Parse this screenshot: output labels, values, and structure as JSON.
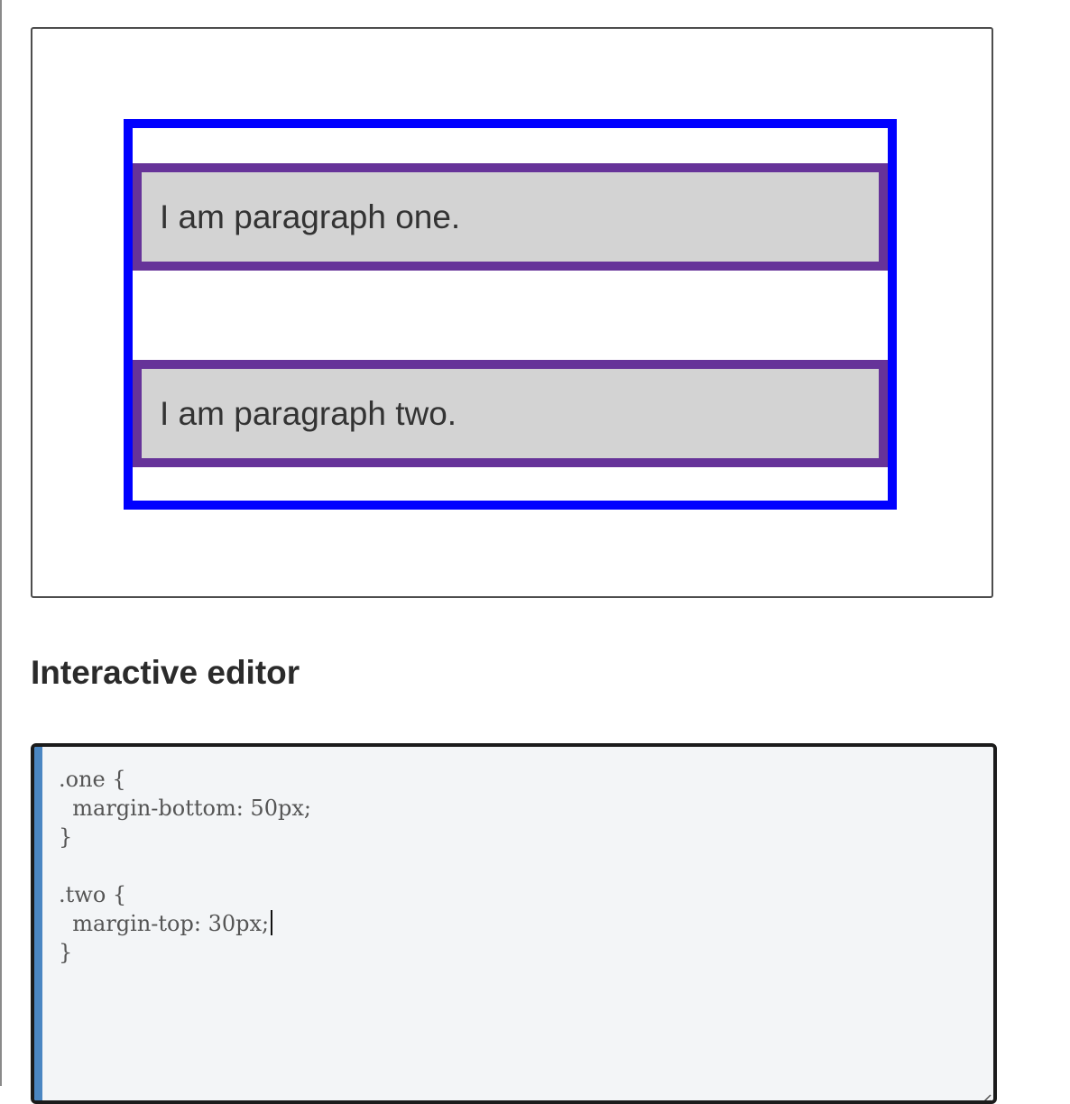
{
  "output": {
    "paragraph_one": "I am paragraph one.",
    "paragraph_two": "I am paragraph two."
  },
  "editor_heading": "Interactive editor",
  "editor": {
    "lines": [
      ".one {",
      "  margin-bottom: 50px;",
      "}",
      "",
      ".two {",
      "  margin-top: 30px;",
      "}"
    ]
  },
  "colors": {
    "container_border": "#0000ff",
    "paragraph_border": "#663399",
    "paragraph_background": "#d3d3d3",
    "editor_gutter": "#4a86c2",
    "editor_background": "#f3f5f7"
  },
  "icons": {
    "resize_grip": "resize-grip-icon"
  }
}
